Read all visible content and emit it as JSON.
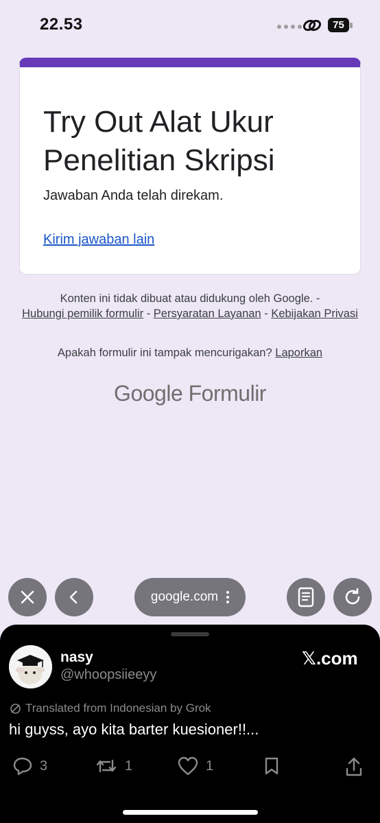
{
  "status_bar": {
    "time": "22.53",
    "battery": "75"
  },
  "form": {
    "title": "Try Out Alat Ukur Penelitian Skripsi",
    "confirmation": "Jawaban Anda telah direkam.",
    "submit_another_link": "Kirim jawaban lain",
    "accent_color": "#673ab7"
  },
  "footer": {
    "disclaimer": "Konten ini tidak dibuat atau didukung oleh Google. -",
    "link_contact_owner": "Hubungi pemilik formulir",
    "link_terms": "Persyaratan Layanan",
    "link_privacy": "Kebijakan Privasi",
    "separator": "-",
    "suspicious_question": "Apakah formulir ini tampak mencurigakan?",
    "report_link": "Laporkan",
    "logo_google": "Google",
    "logo_product": "Formulir"
  },
  "browser": {
    "url": "google.com",
    "icons": [
      "close-icon",
      "back-icon",
      "more-icon",
      "reader-icon",
      "reload-icon"
    ]
  },
  "tweet": {
    "display_name": "nasy",
    "handle": "@whoopsiieeyy",
    "source": "𝕏.com",
    "translated_label": "Translated from Indonesian by Grok",
    "text": "hi guyss, ayo kita barter kuesioner!!...",
    "replies": "3",
    "reposts": "1",
    "likes": "1"
  }
}
